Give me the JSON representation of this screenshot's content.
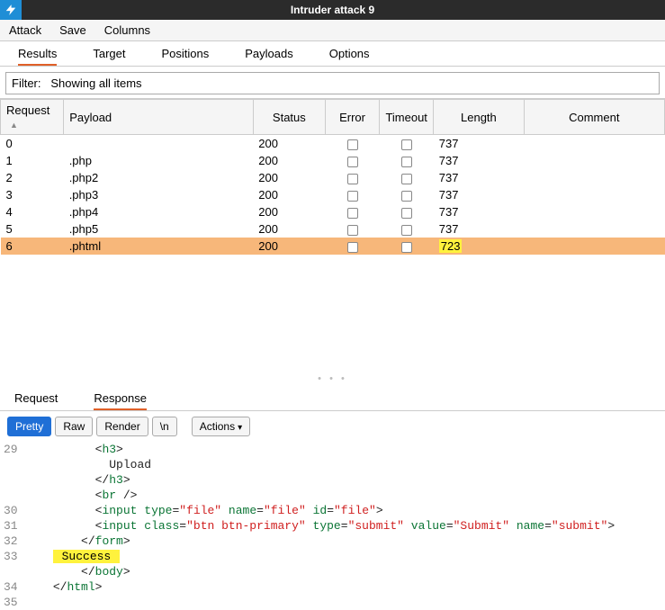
{
  "window": {
    "title": "Intruder attack 9"
  },
  "menubar": [
    "Attack",
    "Save",
    "Columns"
  ],
  "main_tabs": [
    "Results",
    "Target",
    "Positions",
    "Payloads",
    "Options"
  ],
  "active_main_tab": "Results",
  "filter": {
    "label": "Filter:",
    "value": "Showing all items"
  },
  "columns": [
    "Request",
    "Payload",
    "Status",
    "Error",
    "Timeout",
    "Length",
    "Comment"
  ],
  "sorted_col": "Request",
  "rows": [
    {
      "request": "0",
      "payload": "",
      "status": "200",
      "error": false,
      "timeout": false,
      "length": "737",
      "comment": "",
      "selected": false,
      "hl_length": false
    },
    {
      "request": "1",
      "payload": ".php",
      "status": "200",
      "error": false,
      "timeout": false,
      "length": "737",
      "comment": "",
      "selected": false,
      "hl_length": false
    },
    {
      "request": "2",
      "payload": ".php2",
      "status": "200",
      "error": false,
      "timeout": false,
      "length": "737",
      "comment": "",
      "selected": false,
      "hl_length": false
    },
    {
      "request": "3",
      "payload": ".php3",
      "status": "200",
      "error": false,
      "timeout": false,
      "length": "737",
      "comment": "",
      "selected": false,
      "hl_length": false
    },
    {
      "request": "4",
      "payload": ".php4",
      "status": "200",
      "error": false,
      "timeout": false,
      "length": "737",
      "comment": "",
      "selected": false,
      "hl_length": false
    },
    {
      "request": "5",
      "payload": ".php5",
      "status": "200",
      "error": false,
      "timeout": false,
      "length": "737",
      "comment": "",
      "selected": false,
      "hl_length": false
    },
    {
      "request": "6",
      "payload": ".phtml",
      "status": "200",
      "error": false,
      "timeout": false,
      "length": "723",
      "comment": "",
      "selected": true,
      "hl_length": true
    }
  ],
  "lower_tabs": [
    "Request",
    "Response"
  ],
  "active_lower_tab": "Response",
  "viewbar": {
    "modes": [
      "Pretty",
      "Raw",
      "Render"
    ],
    "selected": "Pretty",
    "newline_btn": "\\n",
    "actions_btn": "Actions"
  },
  "code": {
    "lines": [
      {
        "n": "29",
        "indent": 5,
        "t": "tag_open",
        "tag": "h3"
      },
      {
        "n": "",
        "indent": 6,
        "t": "text",
        "text": "Upload"
      },
      {
        "n": "",
        "indent": 5,
        "t": "tag_close",
        "tag": "h3"
      },
      {
        "n": "",
        "indent": 5,
        "t": "self",
        "tag": "br"
      },
      {
        "n": "30",
        "indent": 5,
        "t": "input1",
        "attrs": [
          [
            "type",
            "file"
          ],
          [
            "name",
            "file"
          ],
          [
            "id",
            "file"
          ]
        ]
      },
      {
        "n": "31",
        "indent": 5,
        "t": "input1",
        "attrs": [
          [
            "class",
            "btn btn-primary"
          ],
          [
            "type",
            "submit"
          ],
          [
            "value",
            "Submit"
          ],
          [
            "name",
            "submit"
          ]
        ]
      },
      {
        "n": "32",
        "indent": 4,
        "t": "tag_close",
        "tag": "form"
      },
      {
        "n": "33",
        "indent": 2,
        "t": "hl_text",
        "text": " Success "
      },
      {
        "n": "",
        "indent": 4,
        "t": "tag_close",
        "tag": "body"
      },
      {
        "n": "34",
        "indent": 2,
        "t": "tag_close",
        "tag": "html"
      },
      {
        "n": "35",
        "indent": 0,
        "t": "blank"
      }
    ]
  }
}
